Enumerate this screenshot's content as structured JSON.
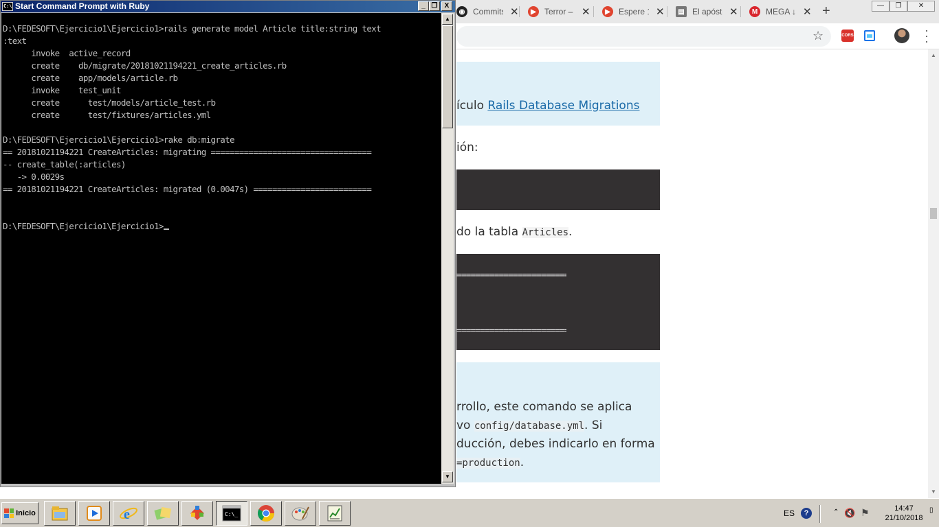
{
  "browser": {
    "tabs": [
      {
        "title": "Commits",
        "icon": "github-icon",
        "color": "#222222"
      },
      {
        "title": "Terror –",
        "icon": "play-icon",
        "color": "#e0442f"
      },
      {
        "title": "Espere 1",
        "icon": "play-icon",
        "color": "#e0442f"
      },
      {
        "title": "El apósto",
        "icon": "clipboard-icon",
        "color": "#555555"
      },
      {
        "title": "MEGA ↓",
        "icon": "mega-icon",
        "color": "#d9272e"
      }
    ],
    "new_tab": "+",
    "window_controls": [
      "—",
      "❐",
      "✕"
    ],
    "extensions": {
      "cors_label": "CORS"
    },
    "page": {
      "info1": {
        "text": "ículo ",
        "link": "Rails Database Migrations"
      },
      "line_migration": "ión:",
      "line_table_prefix": "do la tabla ",
      "line_table_code": "Articles",
      "line_table_suffix": ".",
      "eq_line": "===================================",
      "info2": {
        "line1": "rrollo, este comando se aplica",
        "line2_prefix": "vo ",
        "line2_code": "config/database.yml",
        "line2_suffix": ". Si",
        "line3": "ducción, debes indicarlo en forma",
        "line4_code": "=production",
        "line4_suffix": "."
      }
    }
  },
  "cmd": {
    "title": "Start Command Prompt with Ruby",
    "icon_text": "C:\\",
    "buttons": {
      "minimize": "_",
      "maximize": "❐",
      "close": "X"
    },
    "output": "D:\\FEDESOFT\\Ejercicio1\\Ejercicio1>rails generate model Article title:string text\n:text\n      invoke  active_record\n      create    db/migrate/20181021194221_create_articles.rb\n      create    app/models/article.rb\n      invoke    test_unit\n      create      test/models/article_test.rb\n      create      test/fixtures/articles.yml\n\nD:\\FEDESOFT\\Ejercicio1\\Ejercicio1>rake db:migrate\n== 20181021194221 CreateArticles: migrating ==================================\n-- create_table(:articles)\n   -> 0.0029s\n== 20181021194221 CreateArticles: migrated (0.0047s) =========================\n\n\nD:\\FEDESOFT\\Ejercicio1\\Ejercicio1>"
  },
  "taskbar": {
    "start_label": "Inicio",
    "apps": [
      {
        "name": "file-explorer-icon"
      },
      {
        "name": "media-player-icon"
      },
      {
        "name": "internet-explorer-icon"
      },
      {
        "name": "folders-icon"
      },
      {
        "name": "git-icon"
      },
      {
        "name": "command-prompt-icon",
        "active": true
      },
      {
        "name": "chrome-icon"
      },
      {
        "name": "paint-icon"
      },
      {
        "name": "chart-app-icon"
      }
    ],
    "tray": {
      "language": "ES",
      "help": "?",
      "time": "14:47",
      "date": "21/10/2018"
    }
  }
}
